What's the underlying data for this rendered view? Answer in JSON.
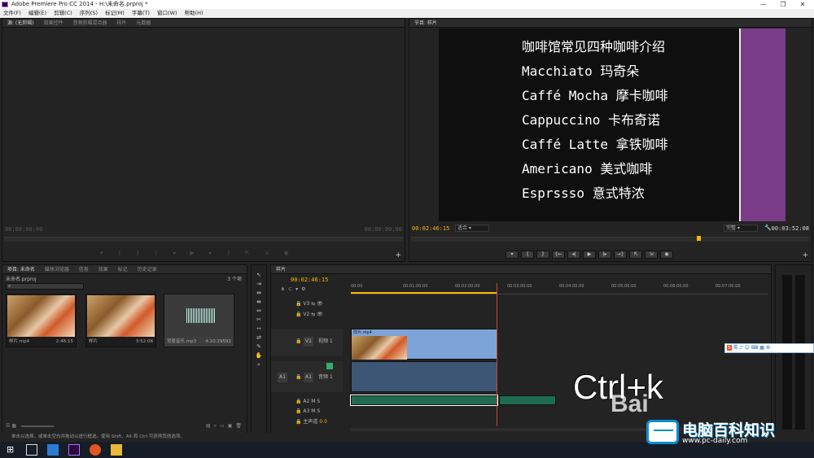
{
  "window": {
    "title": "Adobe Premiere Pro CC 2014 - H:\\未命名.prproj *",
    "controls": [
      "—",
      "❐",
      "✕"
    ]
  },
  "menu": [
    "文件(F)",
    "编辑(E)",
    "剪辑(C)",
    "序列(S)",
    "标记(M)",
    "字幕(T)",
    "窗口(W)",
    "帮助(H)"
  ],
  "source_panel": {
    "tabs": [
      "源: (无剪辑)",
      "效果控件",
      "音频剪辑混合器",
      "样片",
      "元数据"
    ],
    "tc_left": "00;00;00;00",
    "tc_right": "00;00;00;00"
  },
  "program_panel": {
    "tab": "节目: 样片",
    "tc_left": "00:02:46:15",
    "fit": "适合",
    "quality": "完整",
    "tc_right": "00:03:52:08",
    "slide_lines": [
      "咖啡馆常见四种咖啡介绍",
      "Macchiato 玛奇朵",
      "Caffé Mocha 摩卡咖啡",
      "Cappuccino 卡布奇诺",
      "Caffé Latte 拿铁咖啡",
      "Americano 美式咖啡",
      "Esprssso 意式特浓"
    ],
    "buttons": [
      "▾",
      "{",
      "}",
      "{←",
      "◂|",
      "▶",
      "|▸",
      "→}",
      "⇱",
      "⇲",
      "◉"
    ]
  },
  "project_panel": {
    "tabs": [
      "项目: 未命名",
      "媒体浏览器",
      "信息",
      "效果",
      "标记",
      "历史记录"
    ],
    "project_file": "未命名.prproj",
    "item_count": "3 个项",
    "items": [
      {
        "name": "样片.mp4",
        "duration": "2:46:15"
      },
      {
        "name": "样片",
        "duration": "3:52:08"
      },
      {
        "name": "背景音乐.mp3",
        "duration": "4:10:29592"
      }
    ]
  },
  "timeline": {
    "tab": "样片",
    "timecode": "00:02:46:15",
    "ruler": [
      "00:00",
      "00:01:00:00",
      "00:02:00:00",
      "00:03:00:00",
      "00:04:00:00",
      "00:05:00:00",
      "00:06:00:00",
      "00:07:00:00"
    ],
    "playhead_fraction": 0.35,
    "tracks": {
      "v3": "V3",
      "v2": "V2",
      "v1": "V1",
      "v1_name": "视频 1",
      "a1": "A1",
      "a1_name": "音频 1",
      "a2": "A2",
      "a3": "A3",
      "master": "主声道",
      "master_val": "0.0",
      "src_v": "V1",
      "src_a": "A1"
    },
    "clips": {
      "video": "样片.mp4"
    }
  },
  "overlay_text": "Ctrl+k",
  "watermark_text": "Bai",
  "status_text": "单击以选择，或单击空白并拖动以进行框选。使用 Shift、Alt 和 Ctrl 可获得其他选项。",
  "brand": {
    "name": "电脑百科知识",
    "url": "www.pc-daily.com",
    "color": "#0b8fd6"
  },
  "ime": [
    "英",
    "♪",
    "☺",
    "⌨",
    "▦",
    "⚙"
  ]
}
